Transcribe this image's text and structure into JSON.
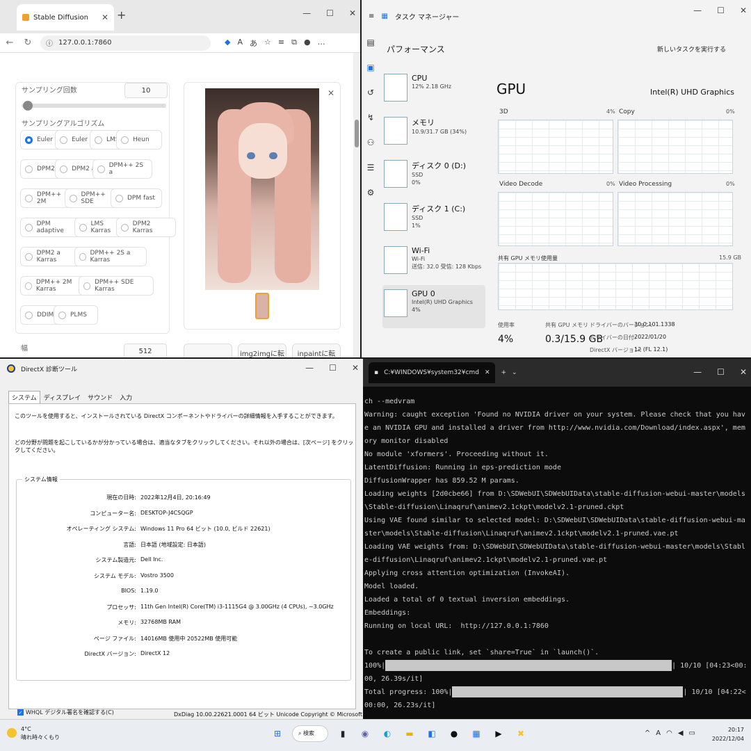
{
  "browser": {
    "tab_title": "Stable Diffusion",
    "url": "127.0.0.1:7860",
    "sampling_steps_label": "サンプリング回数",
    "sampling_steps_value": "10",
    "sampler_label": "サンプリングアルゴリズム",
    "samplers": [
      "Euler a",
      "Euler",
      "LMS",
      "Heun",
      "DPM2",
      "DPM2 a",
      "DPM++ 2S a",
      "DPM++ 2M",
      "DPM++ SDE",
      "DPM fast",
      "DPM adaptive",
      "LMS Karras",
      "DPM2 Karras",
      "DPM2 a Karras",
      "DPM++ 2S a Karras",
      "DPM++ 2M Karras",
      "DPM++ SDE Karras",
      "DDIM",
      "PLMS"
    ],
    "selected_sampler": "Euler a",
    "width_label": "幅",
    "width_value": "512",
    "btn_img2img": "img2imgに転",
    "btn_inpaint": "inpaintに転"
  },
  "taskman": {
    "title": "タスク マネージャー",
    "section": "パフォーマンス",
    "new_task": "新しいタスクを実行する",
    "items": [
      {
        "name": "CPU",
        "sub1": "12% 2.18 GHz",
        "sub2": ""
      },
      {
        "name": "メモリ",
        "sub1": "10.9/31.7 GB (34%)",
        "sub2": ""
      },
      {
        "name": "ディスク 0 (D:)",
        "sub1": "SSD",
        "sub2": "0%"
      },
      {
        "name": "ディスク 1 (C:)",
        "sub1": "SSD",
        "sub2": "1%"
      },
      {
        "name": "Wi-Fi",
        "sub1": "Wi-Fi",
        "sub2": "送信: 32.0 受信: 128 Kbps"
      },
      {
        "name": "GPU 0",
        "sub1": "Intel(R) UHD Graphics",
        "sub2": "4%"
      }
    ],
    "gpu_title": "GPU",
    "gpu_name": "Intel(R) UHD Graphics",
    "graphs": [
      {
        "label": "3D",
        "pct": "4%"
      },
      {
        "label": "Copy",
        "pct": "0%"
      },
      {
        "label": "Video Decode",
        "pct": "0%"
      },
      {
        "label": "Video Processing",
        "pct": "0%"
      }
    ],
    "shared_mem_label": "共有 GPU メモリ使用量",
    "shared_mem_max": "15.9 GB",
    "usage_label": "使用率",
    "usage_value": "4%",
    "shared_label": "共有 GPU メモリ",
    "shared_value": "0.3/15.9 GB",
    "driver_version_label": "ドライバーのバージョン:",
    "driver_version": "30.0.101.1338",
    "driver_date_label": "ドライバーの日付:",
    "driver_date": "2022/01/20",
    "directx_label": "DirectX バージョン:",
    "directx_value": "12 (FL 12.1)"
  },
  "dxdiag": {
    "title": "DirectX 診断ツール",
    "tabs": [
      "システム",
      "ディスプレイ",
      "サウンド",
      "入力"
    ],
    "intro1": "このツールを使用すると、インストールされている DirectX コンポーネントやドライバーの詳細情報を入手することができます。",
    "intro2": "どの分野が問題を起こしているかが分かっている場合は、適当なタブをクリックしてください。それ以外の場合は、[次ページ] をクリックしてください。",
    "group_label": "システム情報",
    "rows": [
      {
        "k": "現在の日時:",
        "v": "2022年12月4日, 20:16:49"
      },
      {
        "k": "コンピューター名:",
        "v": "DESKTOP-J4CSQGP"
      },
      {
        "k": "オペレーティング システム:",
        "v": "Windows 11 Pro 64 ビット (10.0, ビルド 22621)"
      },
      {
        "k": "言語:",
        "v": "日本語 (地域設定: 日本語)"
      },
      {
        "k": "システム製造元:",
        "v": "Dell Inc."
      },
      {
        "k": "システム モデル:",
        "v": "Vostro 3500"
      },
      {
        "k": "BIOS:",
        "v": "1.19.0"
      },
      {
        "k": "プロセッサ:",
        "v": "11th Gen Intel(R) Core(TM) i3-1115G4 @ 3.00GHz (4 CPUs), ~3.0GHz"
      },
      {
        "k": "メモリ:",
        "v": "32768MB RAM"
      },
      {
        "k": "ページ ファイル:",
        "v": "14016MB 使用中 20522MB 使用可能"
      },
      {
        "k": "DirectX バージョン:",
        "v": "DirectX 12"
      }
    ],
    "whql": "WHQL デジタル署名を確認する(C)",
    "footer": "DxDiag 10.00.22621.0001 64 ビット Unicode Copyright © Microsoft. All rights reserved."
  },
  "cmd": {
    "tab_title": "C:¥WINDOWS¥system32¥cmd",
    "lines": [
      "ch --medvram",
      "Warning: caught exception 'Found no NVIDIA driver on your system. Please check that you have an NVIDIA GPU and installed a driver from http://www.nvidia.com/Download/index.aspx', memory monitor disabled",
      "No module 'xformers'. Proceeding without it.",
      "LatentDiffusion: Running in eps-prediction mode",
      "DiffusionWrapper has 859.52 M params.",
      "Loading weights [2d0cbe66] from D:\\SDWebUI\\SDWebUIData\\stable-diffusion-webui-master\\models\\Stable-diffusion\\Linaqruf\\animev2.1ckpt\\modelv2.1-pruned.ckpt",
      "Using VAE found similar to selected model: D:\\SDWebUI\\SDWebUIData\\stable-diffusion-webui-master\\models\\Stable-diffusion\\Linaqruf\\animev2.1ckpt\\modelv2.1-pruned.vae.pt",
      "Loading VAE weights from: D:\\SDWebUI\\SDWebUIData\\stable-diffusion-webui-master\\models\\Stable-diffusion\\Linaqruf\\animev2.1ckpt\\modelv2.1-pruned.vae.pt",
      "Applying cross attention optimization (InvokeAI).",
      "Model loaded.",
      "Loaded a total of 0 textual inversion embeddings.",
      "Embeddings:",
      "Running on local URL:  http://127.0.0.1:7860",
      "",
      "To create a public link, set `share=True` in `launch()`."
    ],
    "progress1_prefix": "100%|",
    "progress1_suffix": "| 10/10 [04:23<00:00, 26.39s/it]",
    "progress2_prefix": "Total progress: 100%|",
    "progress2_suffix": "| 10/10 [04:22<00:00, 26.23s/it]",
    "progress_fraction": 1.0
  },
  "taskbar": {
    "temp": "4°C",
    "weather": "晴れ時々くもり",
    "search": "検索",
    "time": "20:17",
    "date": "2022/12/04"
  }
}
